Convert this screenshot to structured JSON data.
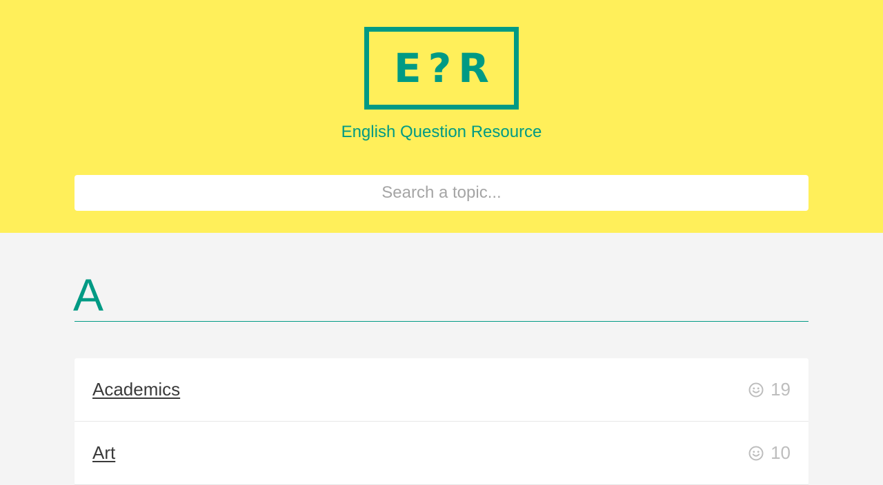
{
  "header": {
    "logo_text": "E?R",
    "subtitle": "English Question Resource"
  },
  "search": {
    "placeholder": "Search a topic...",
    "value": ""
  },
  "section": {
    "letter": "A"
  },
  "topics": [
    {
      "label": "Academics",
      "count": "19",
      "icon": "smiley-icon"
    },
    {
      "label": "Art",
      "count": "10",
      "icon": "smiley-icon"
    }
  ],
  "colors": {
    "header_bg": "#ffef5a",
    "accent": "#009a84",
    "page_bg": "#f4f4f4"
  }
}
